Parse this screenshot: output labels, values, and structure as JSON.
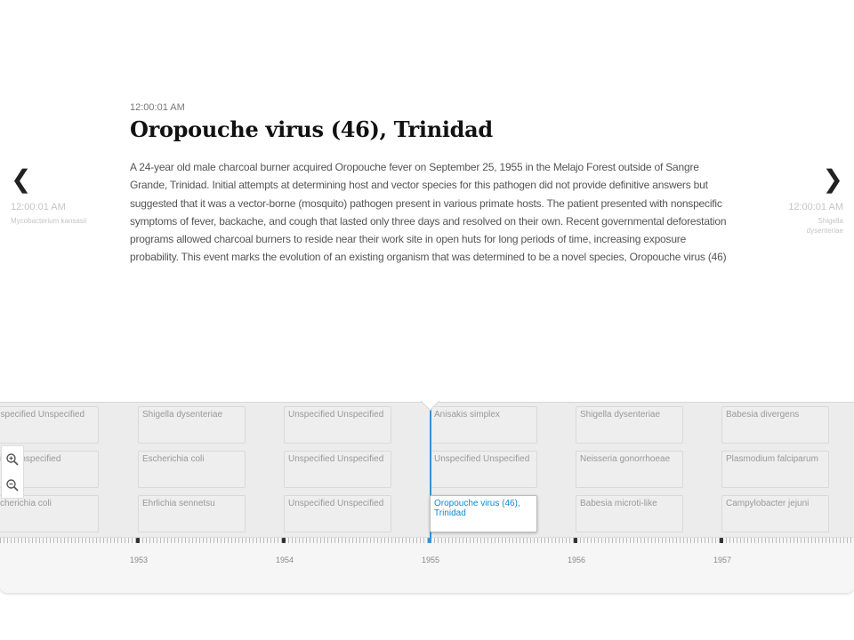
{
  "slide": {
    "time": "12:00:01 AM",
    "title": "Oropouche virus (46), Trinidad",
    "text": "A 24-year old male charcoal burner acquired Oropouche fever on September 25, 1955 in the Melajo Forest outside of Sangre Grande, Trinidad. Initial attempts at determining host and vector species for this pathogen did not provide definitive answers but suggested that it was a vector-borne (mosquito) pathogen present in various primate hosts. The patient presented with nonspecific symptoms of fever, backache, and cough that lasted only three days and resolved on their own. Recent governmental deforestation programs allowed charcoal burners to reside near their work site in open huts for long periods of time, increasing exposure probability. This event marks the evolution of an existing organism that was determined to be a novel species, Oropouche virus (46)"
  },
  "prev": {
    "chevron": "❮",
    "time": "12:00:01 AM",
    "title": "Mycobacterium kansasii"
  },
  "next": {
    "chevron": "❯",
    "time": "12:00:01 AM",
    "title": "Shigella dysenteriae"
  },
  "timeline": {
    "rows": [
      [
        "nspecified Unspecified",
        "Shigella dysenteriae",
        "Unspecified Unspecified",
        "Anisakis simplex",
        "Shigella dysenteriae",
        "Babesia divergens"
      ],
      [
        "ified Unspecified",
        "Escherichia coli",
        "Unspecified Unspecified",
        "Unspecified Unspecified",
        "Neisseria gonorrhoeae",
        "Plasmodium falciparum"
      ],
      [
        "scherichia coli",
        "Ehrlichia sennetsu",
        "Unspecified Unspecified",
        "Oropouche virus (46), Trinidad",
        "Babesia microti-like",
        "Campylobacter jejuni"
      ]
    ],
    "years": [
      "1953",
      "1954",
      "1955",
      "1956",
      "1957"
    ],
    "active_year": "1955",
    "active_color": "#0e8ad3"
  },
  "zoom": {
    "in_icon": "zoom-in-icon",
    "out_icon": "zoom-out-icon"
  }
}
